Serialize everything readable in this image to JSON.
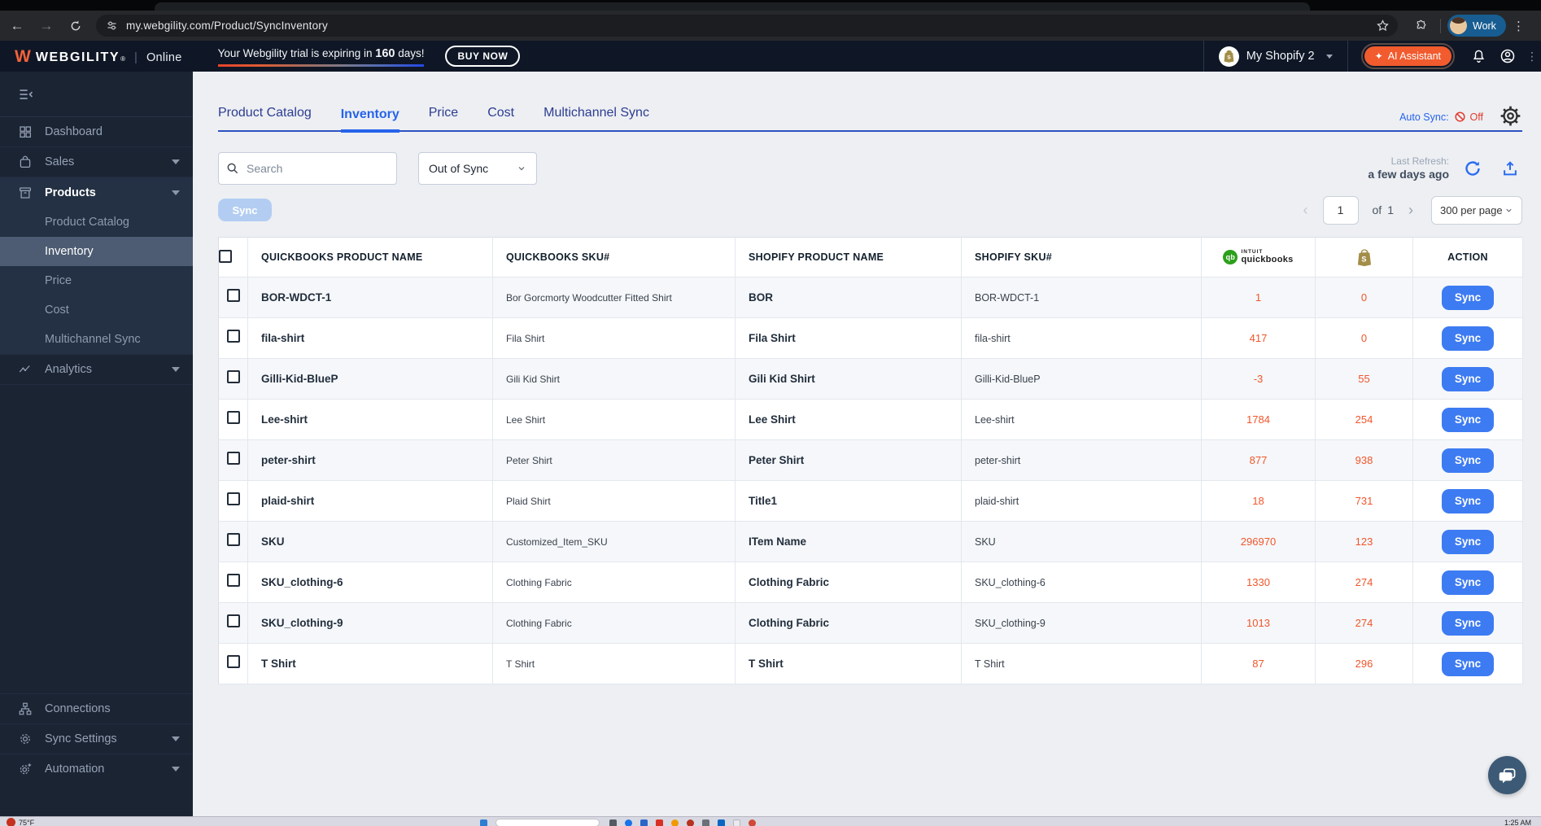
{
  "browser": {
    "url": "my.webgility.com/Product/SyncInventory",
    "profile": "Work"
  },
  "app_header": {
    "brand": "WEBGILITY",
    "brand_mark": "®",
    "mode": "Online",
    "trial_prefix": "Your Webgility trial is expiring in ",
    "trial_days": "160",
    "trial_suffix": " days!",
    "buy_now": "BUY NOW",
    "store": "My Shopify 2",
    "ai_assistant": "AI Assistant"
  },
  "sidebar": {
    "items": [
      {
        "label": "Dashboard"
      },
      {
        "label": "Sales"
      },
      {
        "label": "Products"
      },
      {
        "label": "Product Catalog"
      },
      {
        "label": "Inventory"
      },
      {
        "label": "Price"
      },
      {
        "label": "Cost"
      },
      {
        "label": "Multichannel Sync"
      },
      {
        "label": "Analytics"
      }
    ],
    "bottom": [
      {
        "label": "Connections"
      },
      {
        "label": "Sync Settings"
      },
      {
        "label": "Automation"
      }
    ]
  },
  "content": {
    "tabs": [
      {
        "label": "Product Catalog"
      },
      {
        "label": "Inventory"
      },
      {
        "label": "Price"
      },
      {
        "label": "Cost"
      },
      {
        "label": "Multichannel Sync"
      }
    ],
    "auto_sync_label": "Auto Sync:",
    "auto_sync_state": "Off",
    "search_placeholder": "Search",
    "filter_value": "Out of Sync",
    "last_refresh_label": "Last Refresh:",
    "last_refresh_value": "a few days ago",
    "bulk_sync_label": "Sync",
    "pagination": {
      "page": "1",
      "of": "of",
      "total": "1",
      "per_page": "300 per page"
    },
    "table": {
      "headers": {
        "qb_name": "QUICKBOOKS PRODUCT NAME",
        "qb_sku": "QUICKBOOKS SKU#",
        "shop_name": "SHOPIFY PRODUCT NAME",
        "shop_sku": "SHOPIFY SKU#",
        "qb_logo_top": "INTUIT",
        "qb_logo_bottom": "quickbooks",
        "qb_logo_initials": "qb",
        "action": "ACTION"
      },
      "rows": [
        {
          "qb_name": "BOR-WDCT-1",
          "qb_sku": "Bor Gorcmorty Woodcutter Fitted Shirt",
          "shop_name": "BOR",
          "shop_sku": "BOR-WDCT-1",
          "qb_qty": "1",
          "shop_qty": "0",
          "action": "Sync"
        },
        {
          "qb_name": "fila-shirt",
          "qb_sku": "Fila Shirt",
          "shop_name": "Fila Shirt",
          "shop_sku": "fila-shirt",
          "qb_qty": "417",
          "shop_qty": "0",
          "action": "Sync"
        },
        {
          "qb_name": "Gilli-Kid-BlueP",
          "qb_sku": "Gili Kid Shirt",
          "shop_name": "Gili Kid Shirt",
          "shop_sku": "Gilli-Kid-BlueP",
          "qb_qty": "-3",
          "shop_qty": "55",
          "action": "Sync"
        },
        {
          "qb_name": "Lee-shirt",
          "qb_sku": "Lee Shirt",
          "shop_name": "Lee Shirt",
          "shop_sku": "Lee-shirt",
          "qb_qty": "1784",
          "shop_qty": "254",
          "action": "Sync"
        },
        {
          "qb_name": "peter-shirt",
          "qb_sku": "Peter Shirt",
          "shop_name": "Peter Shirt",
          "shop_sku": "peter-shirt",
          "qb_qty": "877",
          "shop_qty": "938",
          "action": "Sync"
        },
        {
          "qb_name": "plaid-shirt",
          "qb_sku": "Plaid Shirt",
          "shop_name": "Title1",
          "shop_sku": "plaid-shirt",
          "qb_qty": "18",
          "shop_qty": "731",
          "action": "Sync"
        },
        {
          "qb_name": "SKU",
          "qb_sku": "Customized_Item_SKU",
          "shop_name": "ITem Name",
          "shop_sku": "SKU",
          "qb_qty": "296970",
          "shop_qty": "123",
          "action": "Sync"
        },
        {
          "qb_name": "SKU_clothing-6",
          "qb_sku": "Clothing Fabric",
          "shop_name": "Clothing Fabric",
          "shop_sku": "SKU_clothing-6",
          "qb_qty": "1330",
          "shop_qty": "274",
          "action": "Sync"
        },
        {
          "qb_name": "SKU_clothing-9",
          "qb_sku": "Clothing Fabric",
          "shop_name": "Clothing Fabric",
          "shop_sku": "SKU_clothing-9",
          "qb_qty": "1013",
          "shop_qty": "274",
          "action": "Sync"
        },
        {
          "qb_name": "T Shirt",
          "qb_sku": "T Shirt",
          "shop_name": "T Shirt",
          "shop_sku": "T Shirt",
          "qb_qty": "87",
          "shop_qty": "296",
          "action": "Sync"
        }
      ]
    }
  },
  "taskbar": {
    "temp": "75°F",
    "time": "1:25 AM"
  },
  "colors": {
    "accent_orange": "#f15b2e",
    "link_blue": "#2563eb",
    "qty_orange": "#f0562b",
    "sync_blue": "#3d7bf2",
    "qb_green": "#2ca01c",
    "shopify_olive": "#a38e48",
    "alert_red": "#e23a2e"
  }
}
